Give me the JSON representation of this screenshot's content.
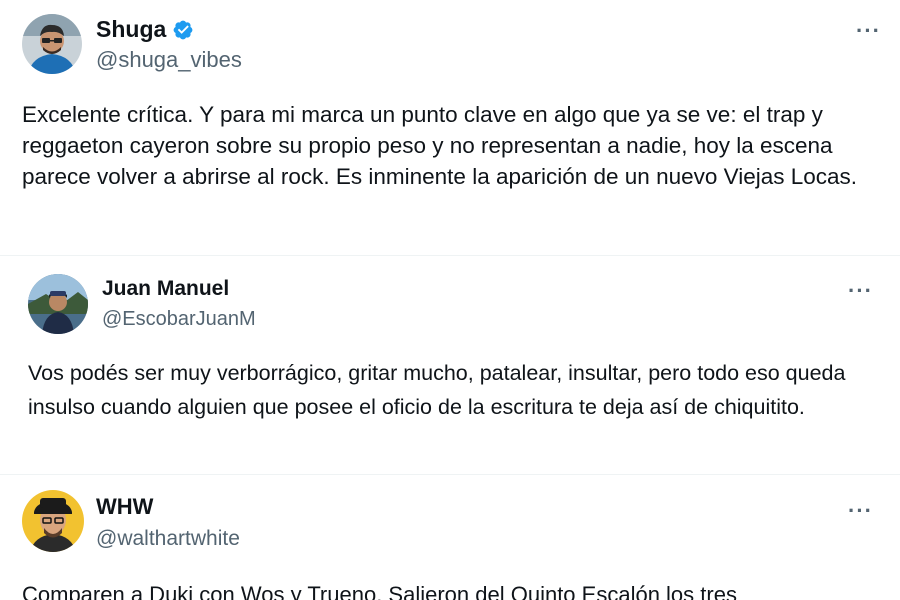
{
  "colors": {
    "text": "#0f1419",
    "secondary": "#536471",
    "verified": "#1d9bf0",
    "divider": "#eff3f4"
  },
  "posts": [
    {
      "display_name": "Shuga",
      "handle": "@shuga_vibes",
      "verified": true,
      "avatar_icon": "avatar-man-glasses",
      "more_label": "···",
      "text": "Excelente crítica. Y para mi marca un punto clave en algo que ya se ve: el trap y reggaeton cayeron sobre su propio peso y no representan a nadie, hoy la escena parece volver a abrirse al rock. Es inminente la aparición de un nuevo Viejas Locas."
    },
    {
      "display_name": "Juan Manuel",
      "handle": "@EscobarJuanM",
      "verified": false,
      "avatar_icon": "avatar-person-outdoors",
      "more_label": "···",
      "text": "Vos podés ser muy verborrágico, gritar mucho, patalear, insultar, pero todo eso queda insulso cuando alguien que posee el oficio de la escritura te deja así de chiquitito."
    },
    {
      "display_name": "WHW",
      "handle": "@walthartwhite",
      "verified": false,
      "avatar_icon": "avatar-heisenberg",
      "more_label": "···",
      "text": "Comparen a Duki con Wos y Trueno. Salieron del Quinto Escalón los tres"
    }
  ]
}
